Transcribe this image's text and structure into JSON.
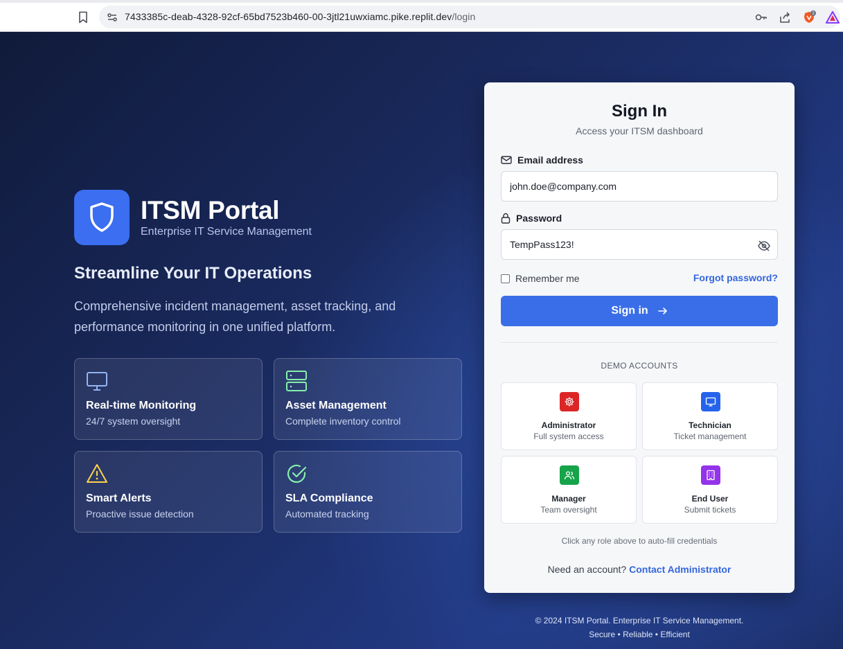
{
  "browser": {
    "url_host": "7433385c-deab-4328-92cf-65bd7523b460-00-3jtl21uwxiamc.pike.replit.dev",
    "url_path": "/login",
    "icons": [
      "bookmark-icon",
      "site-info-icon",
      "key-icon",
      "share-icon",
      "brave-shield-icon",
      "brave-rewards-icon"
    ],
    "shield_count": "2"
  },
  "brand": {
    "icon": "shield-icon",
    "title": "ITSM Portal",
    "subtitle": "Enterprise IT Service Management",
    "accent": "#3b6ef0"
  },
  "hero": {
    "headline": "Streamline Your IT Operations",
    "lead": "Comprehensive incident management, asset tracking, and performance monitoring in one unified platform."
  },
  "features": [
    {
      "icon": "monitor-icon",
      "title": "Real-time Monitoring",
      "desc": "24/7 system oversight",
      "color": "#93b4f5"
    },
    {
      "icon": "server-icon",
      "title": "Asset Management",
      "desc": "Complete inventory control",
      "color": "#86efac"
    },
    {
      "icon": "alert-triangle-icon",
      "title": "Smart Alerts",
      "desc": "Proactive issue detection",
      "color": "#fcd34d"
    },
    {
      "icon": "check-circle-icon",
      "title": "SLA Compliance",
      "desc": "Automated tracking",
      "color": "#86efac"
    }
  ],
  "signin": {
    "title": "Sign In",
    "subtitle": "Access your ITSM dashboard",
    "email_label": "Email address",
    "email_value": "john.doe@company.com",
    "password_label": "Password",
    "password_value": "TempPass123!",
    "remember_label": "Remember me",
    "forgot_label": "Forgot password?",
    "submit_label": "Sign in",
    "demo_heading": "DEMO ACCOUNTS",
    "roles": [
      {
        "icon": "gear-icon",
        "name": "Administrator",
        "desc": "Full system access",
        "color": "#dc2626"
      },
      {
        "icon": "monitor-icon",
        "name": "Technician",
        "desc": "Ticket management",
        "color": "#2563eb"
      },
      {
        "icon": "users-icon",
        "name": "Manager",
        "desc": "Team oversight",
        "color": "#16a34a"
      },
      {
        "icon": "building-icon",
        "name": "End User",
        "desc": "Submit tickets",
        "color": "#9333ea"
      }
    ],
    "hint": "Click any role above to auto-fill credentials",
    "need_account": "Need an account?",
    "contact_label": "Contact Administrator"
  },
  "footer": {
    "line1": "© 2024 ITSM Portal. Enterprise IT Service Management.",
    "line2": "Secure • Reliable • Efficient"
  }
}
